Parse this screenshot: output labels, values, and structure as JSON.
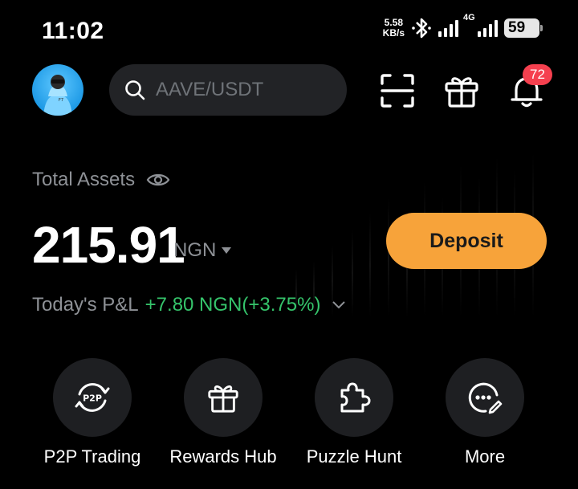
{
  "status_bar": {
    "time": "11:02",
    "net_speed_value": "5.58",
    "net_speed_unit": "KB/s",
    "network_label": "4G",
    "battery": "59"
  },
  "header": {
    "search_placeholder": "AAVE/USDT",
    "notification_count": "72"
  },
  "assets": {
    "label": "Total Assets",
    "amount": "215.91",
    "currency": "NGN",
    "deposit_label": "Deposit",
    "pnl_label": "Today's P&L",
    "pnl_value": "+7.80 NGN(+3.75%)"
  },
  "actions": [
    {
      "label": "P2P Trading",
      "icon": "p2p-icon"
    },
    {
      "label": "Rewards Hub",
      "icon": "gift-icon"
    },
    {
      "label": "Puzzle Hunt",
      "icon": "puzzle-icon"
    },
    {
      "label": "More",
      "icon": "more-icon"
    }
  ],
  "colors": {
    "accent": "#f7a33a",
    "positive": "#35c46b",
    "badge": "#f5404f",
    "muted_text": "#8e9196"
  }
}
